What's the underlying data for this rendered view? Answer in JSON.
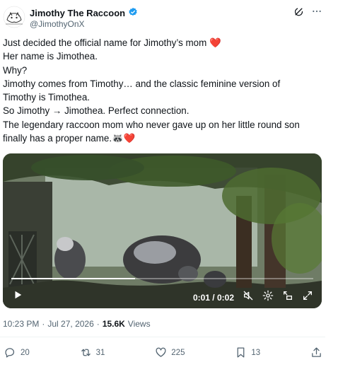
{
  "author": {
    "name": "Jimothy The Raccoon",
    "handle": "@JimothyOnX",
    "verified_color": "#1d9bf0"
  },
  "tweet": {
    "lines": [
      "Just decided the official name for Jimothy’s mom ❤️",
      "Her name is Jimothea.",
      "Why?",
      "Jimothy comes from Timothy… and the classic feminine version of",
      "Timothy is Timothea.",
      "So Jimothy → Jimothea. Perfect connection.",
      "The legendary raccoon mom who never gave up on her little round son",
      "finally has a proper name.🦝❤️"
    ]
  },
  "video": {
    "time": "0:01 / 0:02",
    "progress": 0.41
  },
  "meta": {
    "time": "10:23 PM",
    "separator": "·",
    "date": "Jul 27, 2026",
    "views_count": "15.6K",
    "views_label": "Views"
  },
  "actions": {
    "replies": "20",
    "reposts": "31",
    "likes": "225",
    "bookmarks": "13"
  },
  "colors": {
    "text": "#0f1419",
    "secondary": "#536471",
    "heart": "#f4212e"
  }
}
